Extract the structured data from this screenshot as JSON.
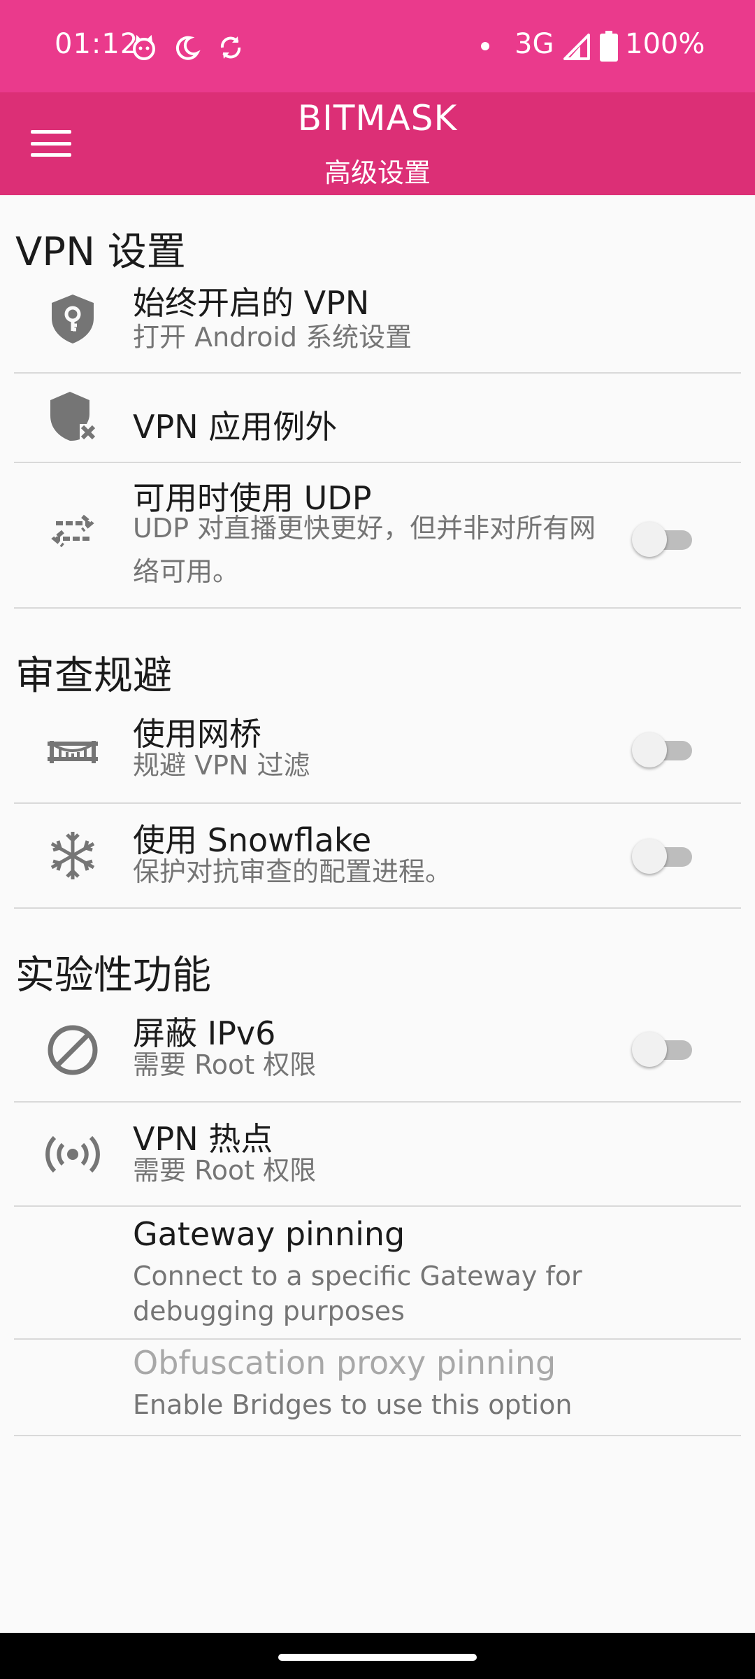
{
  "status_bar": {
    "time": "01:12",
    "network": "3G",
    "battery": "100%",
    "icons": [
      "cat-face-icon",
      "moon-icon",
      "sync-icon",
      "dot-icon",
      "signal-icon",
      "battery-icon"
    ]
  },
  "app_bar": {
    "title": "BITMASK",
    "subtitle": "高级设置",
    "menu_icon": "hamburger-menu-icon"
  },
  "colors": {
    "status_bar": "#ea3a8c",
    "app_bar": "#dc2f76",
    "background": "#fafafa",
    "icon": "#757575",
    "switch_track_off": "#bdbdbd",
    "switch_thumb_off": "#f1f1f1"
  },
  "sections": {
    "vpn": {
      "header": "VPN 设置",
      "always_on": {
        "title": "始终开启的 VPN",
        "summary": "打开 Android 系统设置",
        "icon": "shield-key-icon"
      },
      "exclude_apps": {
        "title": "VPN 应用例外",
        "icon": "shield-x-icon"
      },
      "udp": {
        "title": "可用时使用 UDP",
        "summary": "UDP 对直播更快更好，但并非对所有网络可用。",
        "icon": "swap-arrows-icon",
        "enabled": false
      }
    },
    "censorship": {
      "header": "审查规避",
      "bridges": {
        "title": "使用网桥",
        "summary": "规避 VPN 过滤",
        "icon": "bridge-icon",
        "enabled": false
      },
      "snowflake": {
        "title": "使用 Snowflake",
        "summary": "保护对抗审查的配置进程。",
        "icon": "snowflake-icon",
        "enabled": false
      }
    },
    "experimental": {
      "header": "实验性功能",
      "block_ipv6": {
        "title": "屏蔽 IPv6",
        "summary": "需要 Root 权限",
        "icon": "block-icon",
        "enabled": false
      },
      "vpn_hotspot": {
        "title": "VPN 热点",
        "summary": "需要 Root 权限",
        "icon": "hotspot-icon"
      },
      "gateway_pinning": {
        "title": "Gateway pinning",
        "summary": "Connect to a specific Gateway for debugging purposes"
      },
      "obfs_pinning": {
        "title": "Obfuscation proxy pinning",
        "summary": "Enable Bridges to use this option",
        "disabled": true
      }
    }
  }
}
